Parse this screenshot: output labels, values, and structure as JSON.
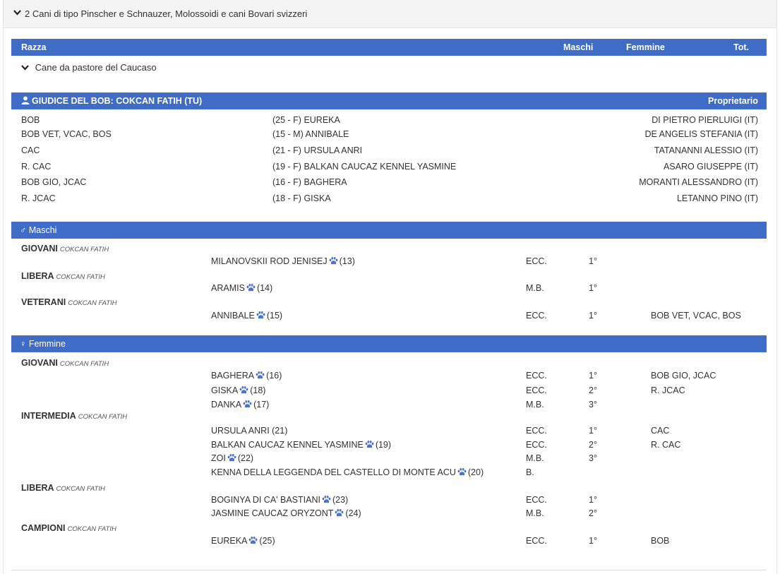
{
  "group": {
    "title": "2 Cani di tipo Pinscher e Schnauzer, Molossoidi e cani Bovari svizzeri"
  },
  "table_header": {
    "razza": "Razza",
    "maschi": "Maschi",
    "femmine": "Femmine",
    "tot": "Tot."
  },
  "breed": {
    "title": "Cane da pastore del Caucaso"
  },
  "bob_section": {
    "title": "GIUDICE DEL BOB: COKCAN FATIH (TU)",
    "owner_label": "Proprietario",
    "rows": [
      {
        "award": "BOB",
        "dog": "(25 - F) EUREKA",
        "owner": "DI PIETRO PIERLUIGI (IT)"
      },
      {
        "award": "BOB VET, VCAC, BOS",
        "dog": "(15 - M) ANNIBALE",
        "owner": "DE ANGELIS STEFANIA (IT)"
      },
      {
        "award": "CAC",
        "dog": "(21 - F) URSULA ANRI",
        "owner": "TATANANNI ALESSIO (IT)"
      },
      {
        "award": "R. CAC",
        "dog": "(19 - F) BALKAN CAUCAZ KENNEL YASMINE",
        "owner": "ASARO GIUSEPPE (IT)"
      },
      {
        "award": "BOB GIO, JCAC",
        "dog": "(16 - F) BAGHERA",
        "owner": "MORANTI ALESSANDRO (IT)"
      },
      {
        "award": "R. JCAC",
        "dog": "(18 - F) GISKA",
        "owner": "LETANNO PINO (IT)"
      }
    ]
  },
  "maschi": {
    "title": "♂ Maschi",
    "classes": [
      {
        "name": "GIOVANI",
        "judge": "COKCAN FATIH",
        "entries": [
          {
            "dog": "MILANOVSKII ROD JENISEJ",
            "num": "(13)",
            "qual": "ECC.",
            "place": "1°",
            "award": ""
          }
        ]
      },
      {
        "name": "LIBERA",
        "judge": "COKCAN FATIH",
        "entries": [
          {
            "dog": "ARAMIS",
            "num": "(14)",
            "qual": "M.B.",
            "place": "1°",
            "award": ""
          }
        ]
      },
      {
        "name": "VETERANI",
        "judge": "COKCAN FATIH",
        "entries": [
          {
            "dog": "ANNIBALE",
            "num": "(15)",
            "qual": "ECC.",
            "place": "1°",
            "award": "BOB VET, VCAC, BOS"
          }
        ]
      }
    ]
  },
  "femmine": {
    "title": "♀ Femmine",
    "classes": [
      {
        "name": "GIOVANI",
        "judge": "COKCAN FATIH",
        "entries": [
          {
            "dog": "BAGHERA",
            "num": "(16)",
            "qual": "ECC.",
            "place": "1°",
            "award": "BOB GIO, JCAC"
          },
          {
            "dog": "GISKA",
            "num": "(18)",
            "qual": "ECC.",
            "place": "2°",
            "award": "R. JCAC"
          },
          {
            "dog": "DANKA",
            "num": "(17)",
            "qual": "M.B.",
            "place": "3°",
            "award": ""
          }
        ]
      },
      {
        "name": "INTERMEDIA",
        "judge": "COKCAN FATIH",
        "entries": [
          {
            "dog": "URSULA ANRI (21)",
            "num": "",
            "qual": "ECC.",
            "place": "1°",
            "award": "CAC"
          },
          {
            "dog": "BALKAN CAUCAZ KENNEL YASMINE",
            "num": "(19)",
            "qual": "ECC.",
            "place": "2°",
            "award": "R. CAC"
          },
          {
            "dog": "ZOI",
            "num": "(22)",
            "qual": "M.B.",
            "place": "3°",
            "award": ""
          },
          {
            "dog": "KENNA DELLA LEGGENDA DEL CASTELLO DI MONTE ACU",
            "num": "(20)",
            "qual": "B.",
            "place": "",
            "award": ""
          }
        ]
      },
      {
        "name": "LIBERA",
        "judge": "COKCAN FATIH",
        "entries": [
          {
            "dog": "BOGINYA DI CA' BASTIANI",
            "num": "(23)",
            "qual": "ECC.",
            "place": "1°",
            "award": ""
          },
          {
            "dog": "JASMINE CAUCAZ ORYZONT",
            "num": "(24)",
            "qual": "M.B.",
            "place": "2°",
            "award": ""
          }
        ]
      },
      {
        "name": "CAMPIONI",
        "judge": "COKCAN FATIH",
        "entries": [
          {
            "dog": "EUREKA",
            "num": "(25)",
            "qual": "ECC.",
            "place": "1°",
            "award": "BOB"
          }
        ]
      }
    ]
  },
  "icons": {
    "chevron": "chevron-down-icon",
    "user": "user-icon",
    "paw": "paw-icon"
  },
  "colors": {
    "bar": "#3f6cc6",
    "header_bg": "#f3f3f3"
  }
}
